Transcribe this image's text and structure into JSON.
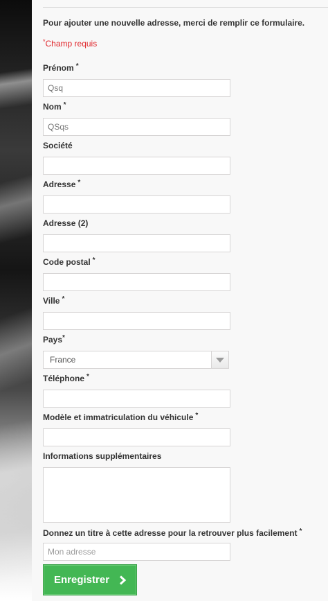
{
  "form": {
    "intro": "Pour ajouter une nouvelle adresse, merci de remplir ce formulaire.",
    "required_note": "Champ requis",
    "required_star": "*",
    "fields": {
      "firstname": {
        "label": "Prénom",
        "value": "Qsq"
      },
      "lastname": {
        "label": "Nom",
        "value": "QSqs"
      },
      "company": {
        "label": "Société",
        "value": ""
      },
      "address1": {
        "label": "Adresse",
        "value": ""
      },
      "address2": {
        "label": "Adresse (2)",
        "value": ""
      },
      "postcode": {
        "label": "Code postal",
        "value": ""
      },
      "city": {
        "label": "Ville",
        "value": ""
      },
      "country": {
        "label": "Pays",
        "value": "France"
      },
      "phone": {
        "label": "Téléphone",
        "value": ""
      },
      "vehicle": {
        "label": "Modèle et immatriculation du véhicule",
        "value": ""
      },
      "other": {
        "label": "Informations supplémentaires",
        "value": ""
      },
      "alias": {
        "label": "Donnez un titre à cette adresse pour la retrouver plus facilement",
        "placeholder": "Mon adresse"
      }
    },
    "submit_label": "Enregistrer",
    "submit_icon": "chevron-right-icon"
  },
  "colors": {
    "required": "#e0262b",
    "button": "#43b754"
  }
}
